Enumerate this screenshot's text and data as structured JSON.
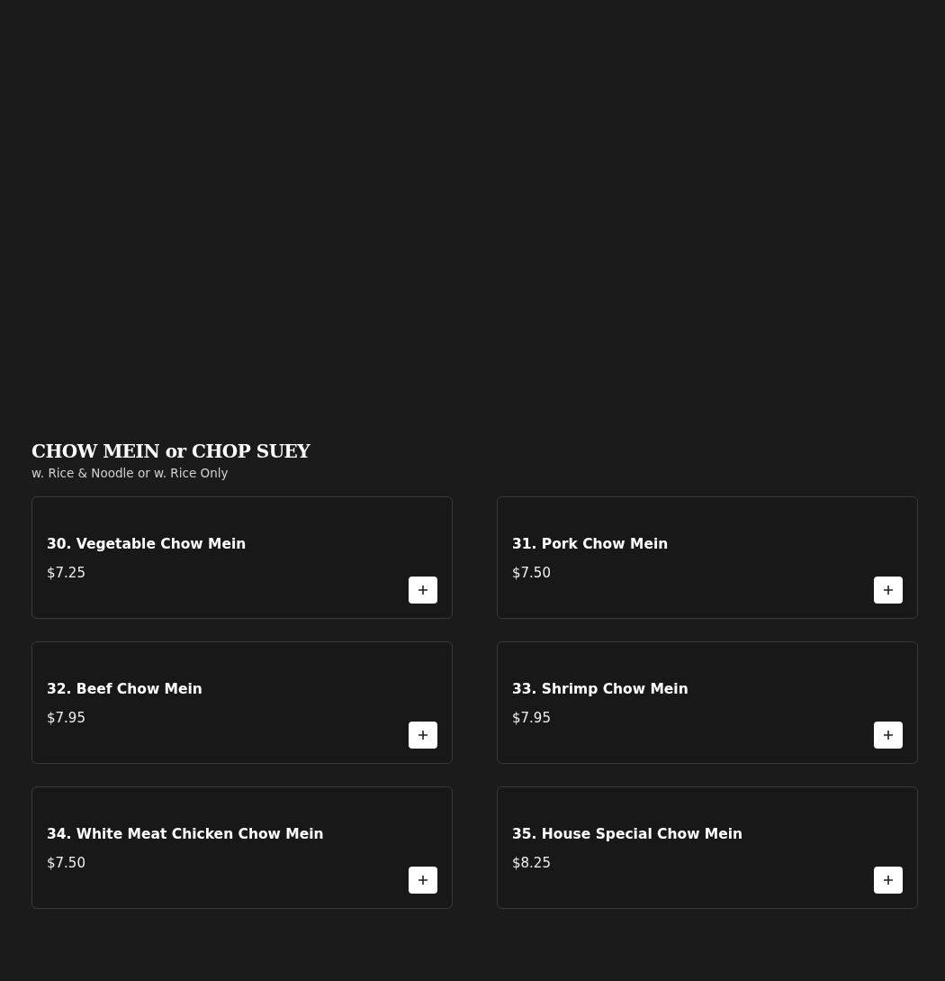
{
  "section": {
    "title": "CHOW MEIN or CHOP SUEY",
    "subtitle": "w. Rice & Noodle or w. Rice Only"
  },
  "items": [
    {
      "name": "30. Vegetable Chow Mein",
      "price": "$7.25"
    },
    {
      "name": "31. Pork Chow Mein",
      "price": "$7.50"
    },
    {
      "name": "32. Beef Chow Mein",
      "price": "$7.95"
    },
    {
      "name": "33. Shrimp Chow Mein",
      "price": "$7.95"
    },
    {
      "name": "34. White Meat Chicken Chow Mein",
      "price": "$7.50"
    },
    {
      "name": "35. House Special Chow Mein",
      "price": "$8.25"
    }
  ]
}
